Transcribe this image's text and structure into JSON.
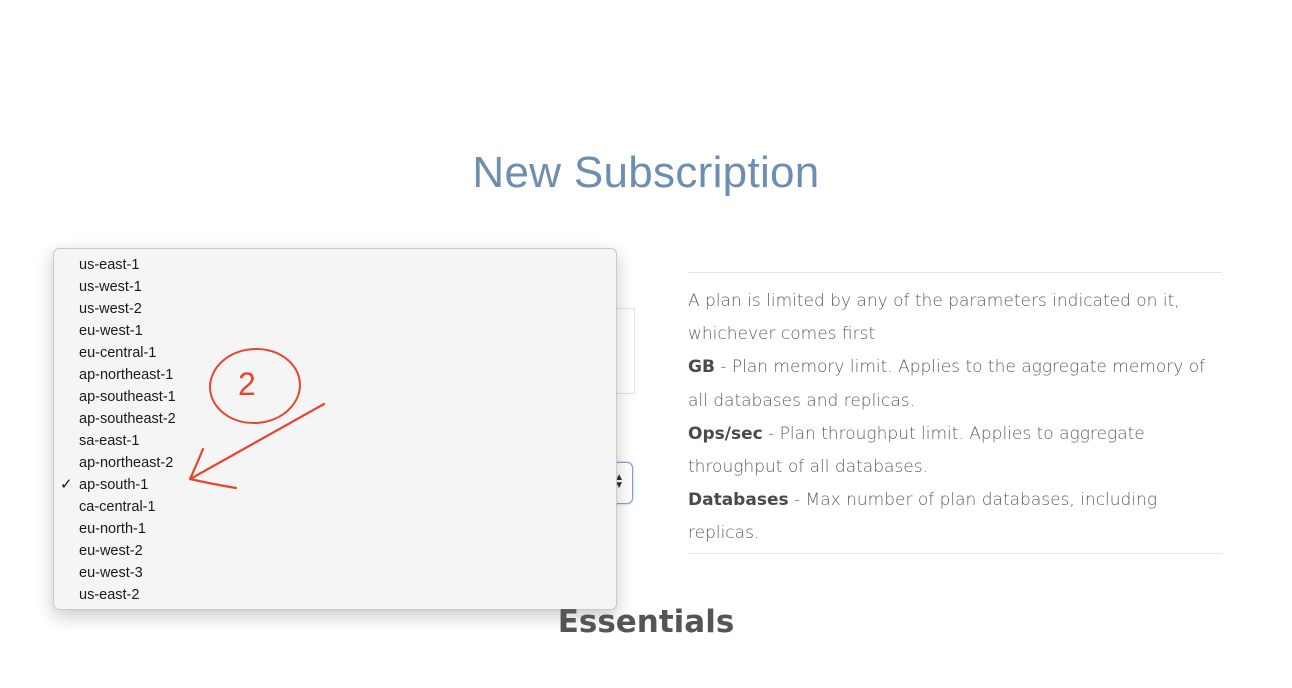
{
  "page": {
    "title": "New Subscription",
    "section_heading": "Essentials"
  },
  "dropdown": {
    "selected": "ap-south-1",
    "options": [
      "us-east-1",
      "us-west-1",
      "us-west-2",
      "eu-west-1",
      "eu-central-1",
      "ap-northeast-1",
      "ap-southeast-1",
      "ap-southeast-2",
      "sa-east-1",
      "ap-northeast-2",
      "ap-south-1",
      "ca-central-1",
      "eu-north-1",
      "eu-west-2",
      "eu-west-3",
      "us-east-2"
    ],
    "check_icon": "check-icon",
    "check_glyph": "✓"
  },
  "info": {
    "intro": "A plan is limited by any of the parameters indicated on it, whichever comes first",
    "gb_term": "GB",
    "gb_desc": " - Plan memory limit. Applies to the aggregate memory of all databases and replicas.",
    "ops_term": "Ops/sec",
    "ops_desc": " - Plan throughput limit. Applies to aggregate throughput of all databases.",
    "db_term": "Databases",
    "db_desc": " - Max number of plan databases, including replicas."
  },
  "annotation": {
    "number": "2",
    "color": "#e8452f"
  },
  "colors": {
    "title": "#6d8db1",
    "select_focus": "#7ea2cf"
  }
}
